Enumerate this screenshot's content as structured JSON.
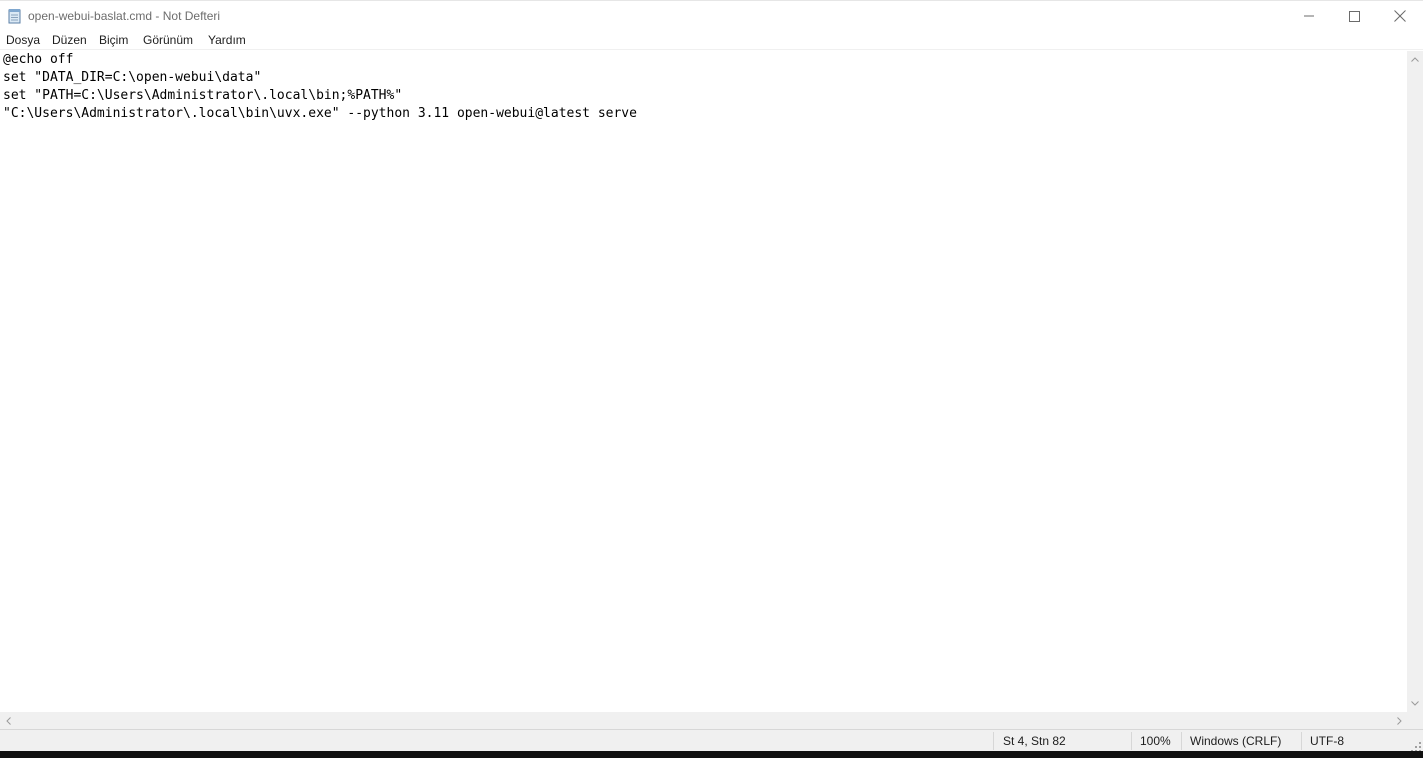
{
  "window": {
    "title": "open-webui-baslat.cmd - Not Defteri",
    "app_icon": "notepad-icon"
  },
  "controls": {
    "minimize_icon": "minimize-icon",
    "maximize_icon": "maximize-icon",
    "close_icon": "close-icon"
  },
  "menu": {
    "items": [
      {
        "label": "Dosya"
      },
      {
        "label": "Düzen"
      },
      {
        "label": "Biçim"
      },
      {
        "label": "Görünüm"
      },
      {
        "label": "Yardım"
      }
    ]
  },
  "editor": {
    "lines": [
      "@echo off",
      "set \"DATA_DIR=C:\\open-webui\\data\"",
      "set \"PATH=C:\\Users\\Administrator\\.local\\bin;%PATH%\"",
      "\"C:\\Users\\Administrator\\.local\\bin\\uvx.exe\" --python 3.11 open-webui@latest serve"
    ]
  },
  "status": {
    "position": "St 4, Stn 82",
    "zoom": "100%",
    "line_ending": "Windows (CRLF)",
    "encoding": "UTF-8"
  }
}
